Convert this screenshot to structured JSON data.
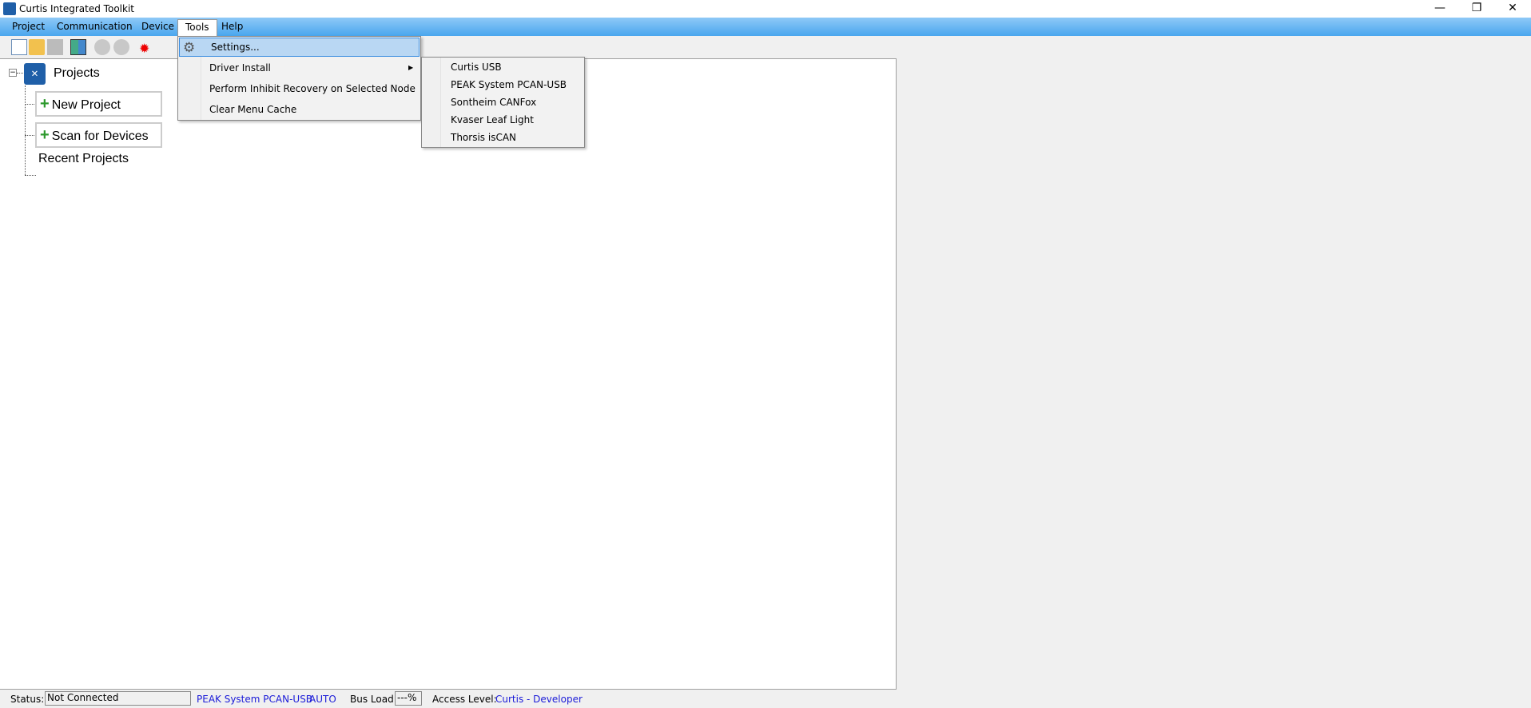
{
  "window": {
    "title": "Curtis Integrated Toolkit",
    "controls": {
      "minimize": "—",
      "restore": "❐",
      "close": "✕"
    }
  },
  "menubar": [
    "Project",
    "Communication",
    "Device",
    "Tools",
    "Help"
  ],
  "tools_menu": {
    "items": [
      "Settings...",
      "Driver Install",
      "Perform Inhibit Recovery on Selected Node",
      "Clear Menu Cache"
    ],
    "submenu_arrow": "▶"
  },
  "driver_submenu": [
    "Curtis USB",
    "PEAK System PCAN-USB",
    "Sontheim CANFox",
    "Kvaser Leaf Light",
    "Thorsis isCAN"
  ],
  "tree": {
    "root": "Projects",
    "expander": "−",
    "new_project": "New Project",
    "scan": "Scan for Devices",
    "recent": "Recent Projects",
    "plus": "+"
  },
  "status": {
    "status_label": "Status:",
    "status_value": "Not Connected",
    "interface": "PEAK System PCAN-USB",
    "mode": "AUTO",
    "bus_load_label": "Bus Load:",
    "bus_load_value": "---%",
    "access_label": "Access Level:",
    "access_value": "Curtis - Developer"
  }
}
